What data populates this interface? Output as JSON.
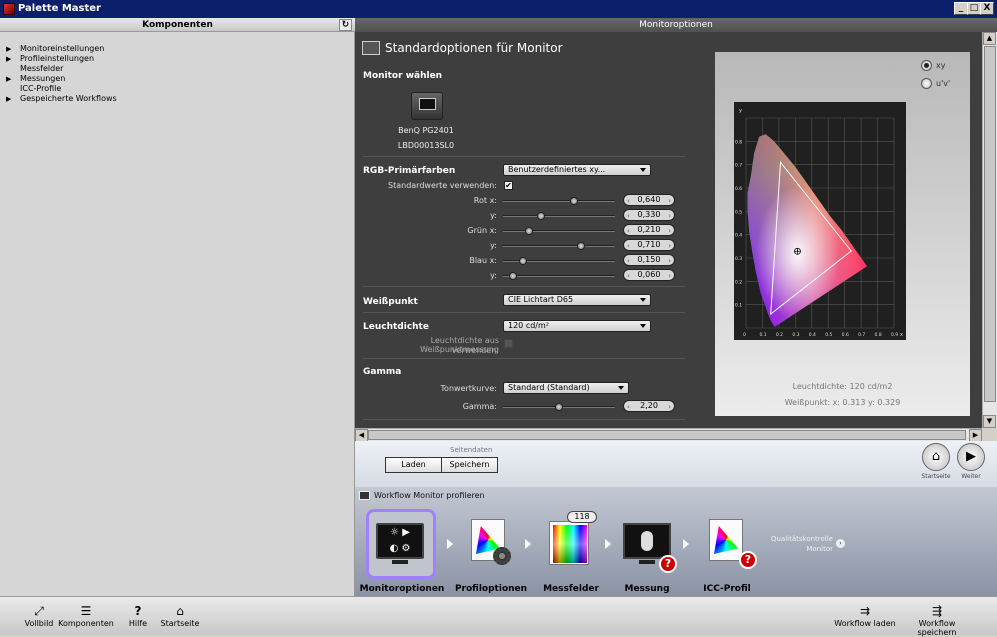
{
  "window": {
    "title": "Palette Master",
    "min": "_",
    "max": "□",
    "close": "X"
  },
  "left": {
    "header": "Komponenten",
    "refresh_icon": "refresh-icon",
    "tree": [
      {
        "label": "Monitoreinstellungen",
        "expandable": true
      },
      {
        "label": "Profileinstellungen",
        "expandable": true
      },
      {
        "label": "Messfelder",
        "expandable": false
      },
      {
        "label": "Messungen",
        "expandable": true
      },
      {
        "label": "ICC-Profile",
        "expandable": false
      },
      {
        "label": "Gespeicherte Workflows",
        "expandable": true
      }
    ]
  },
  "right": {
    "header": "Monitoroptionen",
    "title": "Standardoptionen für Monitor",
    "monitor": {
      "section": "Monitor wählen",
      "name": "BenQ PG2401",
      "serial": "LBD00013SL0"
    },
    "rgb": {
      "section": "RGB-Primärfarben",
      "dropdown": "Benutzerdefiniertes xy...",
      "std_label": "Standardwerte verwenden:",
      "rows": [
        {
          "label": "Rot x:",
          "value": "0,640",
          "pos": 0.64
        },
        {
          "label": "y:",
          "value": "0,330",
          "pos": 0.33
        },
        {
          "label": "Grün x:",
          "value": "0,210",
          "pos": 0.21
        },
        {
          "label": "y:",
          "value": "0,710",
          "pos": 0.71
        },
        {
          "label": "Blau x:",
          "value": "0,150",
          "pos": 0.15
        },
        {
          "label": "y:",
          "value": "0,060",
          "pos": 0.06
        }
      ]
    },
    "whitepoint": {
      "section": "Weißpunkt",
      "dropdown": "CIE Lichtart D65"
    },
    "luminance": {
      "section": "Leuchtdichte",
      "dropdown": "120 cd/m²",
      "measure_label_1": "Leuchtdichte aus Weißpunktmessung",
      "measure_label_2": "verwenden:"
    },
    "gamma": {
      "section": "Gamma",
      "curve_label": "Tonwertkurve:",
      "curve_value": "Standard (Standard)",
      "gamma_label": "Gamma:",
      "gamma_value": "2,20",
      "pos": 0.5
    },
    "chart": {
      "radio_xy": "xy",
      "radio_uv": "u'v'",
      "x_ticks": [
        "0",
        "0.1",
        "0.2",
        "0.3",
        "0.4",
        "0.5",
        "0.6",
        "0.7",
        "0.8",
        "0.9"
      ],
      "y_ticks": [
        "0.1",
        "0.2",
        "0.3",
        "0.4",
        "0.5",
        "0.6",
        "0.7",
        "0.8"
      ],
      "y_axis_label": "y",
      "x_axis_label": "x",
      "luminance_text": "Leuchtdichte: 120 cd/m2",
      "whitepoint_text": "Weißpunkt: x: 0.313  y: 0.329"
    }
  },
  "nav": {
    "seitendaten": "Seitendaten",
    "load": "Laden",
    "save": "Speichern",
    "home_label": "Startseite",
    "next_label": "Weiter"
  },
  "workflow": {
    "title": "Workflow Monitor profileren",
    "badge": "118",
    "steps": [
      "Monitoroptionen",
      "Profiloptionen",
      "Messfelder",
      "Messung",
      "ICC-Profil"
    ],
    "quality_1": "Qualitätskontrolle",
    "quality_2": "Monitor"
  },
  "toolbar": {
    "vollbild": "Vollbild",
    "komponenten": "Komponenten",
    "hilfe": "Hilfe",
    "startseite": "Startseite",
    "workflow_laden": "Workflow laden",
    "workflow_speichern": "Workflow speichern"
  }
}
